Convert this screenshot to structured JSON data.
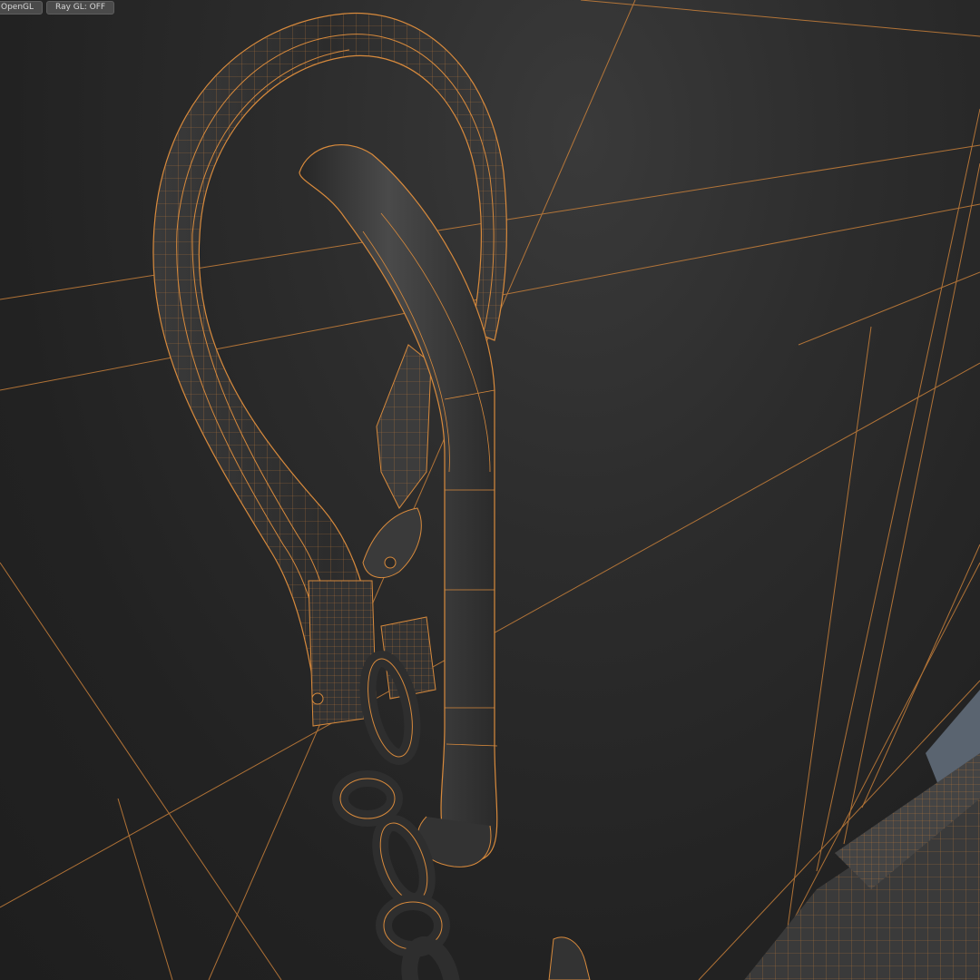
{
  "toolbar": {
    "renderer_label": "OpenGL",
    "raygl_label": "Ray GL: OFF"
  },
  "viewport": {
    "background": "#262626",
    "wireframe_color": "#d88a3c",
    "mesh_fill": "#2f2f2f",
    "floor_fill": "#5a6470"
  }
}
